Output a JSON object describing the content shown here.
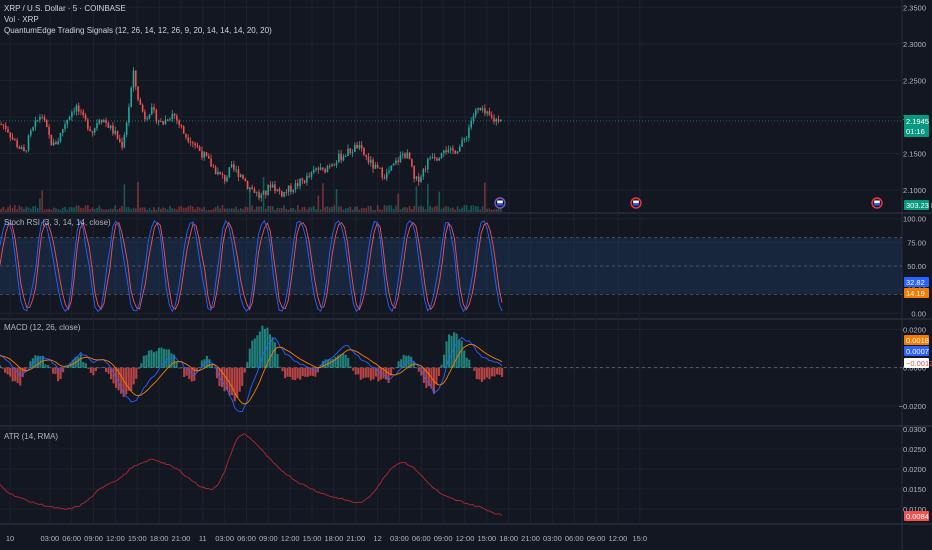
{
  "header": {
    "symbol_line": "XRP / U.S. Dollar · 5 · COINBASE",
    "volume_line": "Vol · XRP",
    "indicator_line": "QuantumEdge Trading Signals (12, 26, 14, 12, 26, 9, 20, 14, 14, 14, 20, 20)"
  },
  "panes": {
    "stoch_label": "Stoch RSI (3, 3, 14, 14, close)",
    "macd_label": "MACD (12, 26, close)",
    "atr_label": "ATR (14, RMA)"
  },
  "badges": {
    "price_value": "2.1945",
    "price_timer": "01:16",
    "volume_value": "303.23 K",
    "stoch_k": "32.82",
    "stoch_d": "14.19",
    "macd_1": "0.0018",
    "macd_2": "0.0007",
    "macd_3": "−0.0012",
    "atr": "0.0084"
  },
  "colors": {
    "background": "#131722",
    "grid": "#2a2e39",
    "up": "#26a69a",
    "down": "#ef5350",
    "stoch_k": "#2962ff",
    "stoch_d": "#ef5350",
    "atr_line": "#b22833",
    "band_fill": "#1e3a5f",
    "price_badge": "#089981",
    "stoch_d_badge": "#f57c00",
    "macd_badge_1": "#f57c00",
    "macd_badge_2": "#2962ff"
  },
  "chart_data": [
    {
      "type": "candlestick",
      "name_in_legend": "XRP / U.S. Dollar",
      "ylim": [
        2.07,
        2.36
      ],
      "y_ticks": [
        "2.3500",
        "2.3000",
        "2.2500",
        "2.2000",
        "2.1500",
        "2.1000"
      ],
      "y_tick_values": [
        2.35,
        2.3,
        2.25,
        2.2,
        2.15,
        2.1
      ],
      "close_path": [
        2.19,
        2.185,
        2.17,
        2.16,
        2.15,
        2.175,
        2.19,
        2.205,
        2.18,
        2.16,
        2.17,
        2.19,
        2.205,
        2.215,
        2.2,
        2.19,
        2.18,
        2.2,
        2.195,
        2.185,
        2.175,
        2.16,
        2.2,
        2.26,
        2.22,
        2.2,
        2.21,
        2.2,
        2.19,
        2.2,
        2.205,
        2.19,
        2.175,
        2.17,
        2.16,
        2.15,
        2.14,
        2.13,
        2.12,
        2.115,
        2.13,
        2.125,
        2.12,
        2.105,
        2.1,
        2.09,
        2.095,
        2.11,
        2.1,
        2.095,
        2.1,
        2.105,
        2.11,
        2.115,
        2.12,
        2.13,
        2.125,
        2.135,
        2.14,
        2.145,
        2.15,
        2.155,
        2.16,
        2.15,
        2.14,
        2.13,
        2.125,
        2.12,
        2.13,
        2.14,
        2.15,
        2.145,
        2.11,
        2.12,
        2.135,
        2.15,
        2.145,
        2.16,
        2.15,
        2.155,
        2.16,
        2.175,
        2.2,
        2.21,
        2.205,
        2.2,
        2.195,
        2.2
      ],
      "x_range": [
        0,
        502
      ],
      "volume_spikes_visible": true,
      "latest_price": 2.1945
    },
    {
      "type": "line",
      "pane": "Stoch RSI",
      "ylim": [
        -5,
        105
      ],
      "y_ticks": [
        "100.00",
        "75.00",
        "50.00",
        "25.00",
        "0.00"
      ],
      "y_tick_values": [
        100,
        75,
        50,
        25,
        0
      ],
      "bands": [
        20,
        80
      ],
      "series_k_last": 32.82,
      "series_d_last": 14.19
    },
    {
      "type": "bar+line",
      "pane": "MACD",
      "ylim": [
        -0.03,
        0.025
      ],
      "y_ticks": [
        "0.0200",
        "0.0000",
        "−0.0200"
      ],
      "y_tick_values": [
        0.02,
        0.0,
        -0.02
      ],
      "macd_path": [
        0.006,
        0.004,
        0.0,
        -0.004,
        -0.002,
        0.003,
        0.006,
        0.005,
        0.002,
        -0.002,
        0.001,
        0.004,
        0.008,
        0.006,
        0.003,
        0.005,
        0.002,
        -0.002,
        -0.01,
        -0.016,
        -0.018,
        -0.014,
        -0.008,
        -0.004,
        0.0,
        0.004,
        0.006,
        0.003,
        -0.001,
        -0.004,
        0.0,
        0.004,
        0.002,
        -0.006,
        -0.012,
        -0.02,
        -0.024,
        -0.016,
        -0.006,
        0.004,
        0.012,
        0.016,
        0.01,
        0.006,
        0.004,
        0.002,
        0.0,
        -0.002,
        0.001,
        0.004,
        0.006,
        0.01,
        0.012,
        0.008,
        0.004,
        0.002,
        0.0,
        -0.003,
        -0.006,
        -0.004,
        0.0,
        0.004,
        0.003,
        -0.002,
        -0.008,
        -0.014,
        -0.008,
        0.004,
        0.012,
        0.016,
        0.014,
        0.01,
        0.006,
        0.004,
        0.003,
        0.001
      ],
      "last_values": [
        0.0018,
        0.0007,
        -0.0012
      ]
    },
    {
      "type": "line",
      "pane": "ATR",
      "ylim": [
        0.0065,
        0.0305
      ],
      "y_ticks": [
        "0.0300",
        "0.0250",
        "0.0200",
        "0.0150",
        "0.0100"
      ],
      "y_tick_values": [
        0.03,
        0.025,
        0.02,
        0.015,
        0.01
      ],
      "atr_path": [
        0.016,
        0.0145,
        0.0135,
        0.0128,
        0.0122,
        0.0116,
        0.0112,
        0.0108,
        0.0104,
        0.0101,
        0.0099,
        0.0102,
        0.0108,
        0.0118,
        0.0132,
        0.0148,
        0.016,
        0.0168,
        0.0175,
        0.0188,
        0.0205,
        0.021,
        0.0218,
        0.0225,
        0.022,
        0.0214,
        0.0206,
        0.0198,
        0.0185,
        0.0172,
        0.016,
        0.0152,
        0.0148,
        0.0162,
        0.0192,
        0.024,
        0.028,
        0.0288,
        0.0275,
        0.026,
        0.024,
        0.0222,
        0.0205,
        0.0192,
        0.018,
        0.0168,
        0.016,
        0.0152,
        0.0144,
        0.0138,
        0.0132,
        0.0128,
        0.0124,
        0.012,
        0.0115,
        0.0118,
        0.0132,
        0.0152,
        0.0175,
        0.0198,
        0.0212,
        0.0218,
        0.021,
        0.0198,
        0.018,
        0.0162,
        0.0148,
        0.0135,
        0.0128,
        0.0122,
        0.0118,
        0.0112,
        0.0108,
        0.0103,
        0.0096,
        0.0089,
        0.0084
      ],
      "last_value": 0.0084
    }
  ],
  "x_axis": {
    "labels": [
      "10",
      "03:00",
      "06:00",
      "09:00",
      "12:00",
      "15:00",
      "18:00",
      "21:00",
      "11",
      "03:00",
      "06:00",
      "09:00",
      "12:00",
      "15:00",
      "18:00",
      "21:00",
      "12",
      "03:00",
      "06:00",
      "09:00",
      "12:00",
      "15:00",
      "18:00",
      "21:00",
      "03:00",
      "06:00",
      "09:00",
      "12:00",
      "15:0"
    ],
    "label_pos_index": [
      0,
      1,
      2,
      3,
      4,
      5,
      6,
      7,
      8,
      9,
      10,
      11,
      12,
      13,
      14,
      15,
      16,
      17,
      18,
      19,
      20,
      21,
      22,
      23,
      24,
      25,
      26,
      27,
      28
    ]
  }
}
